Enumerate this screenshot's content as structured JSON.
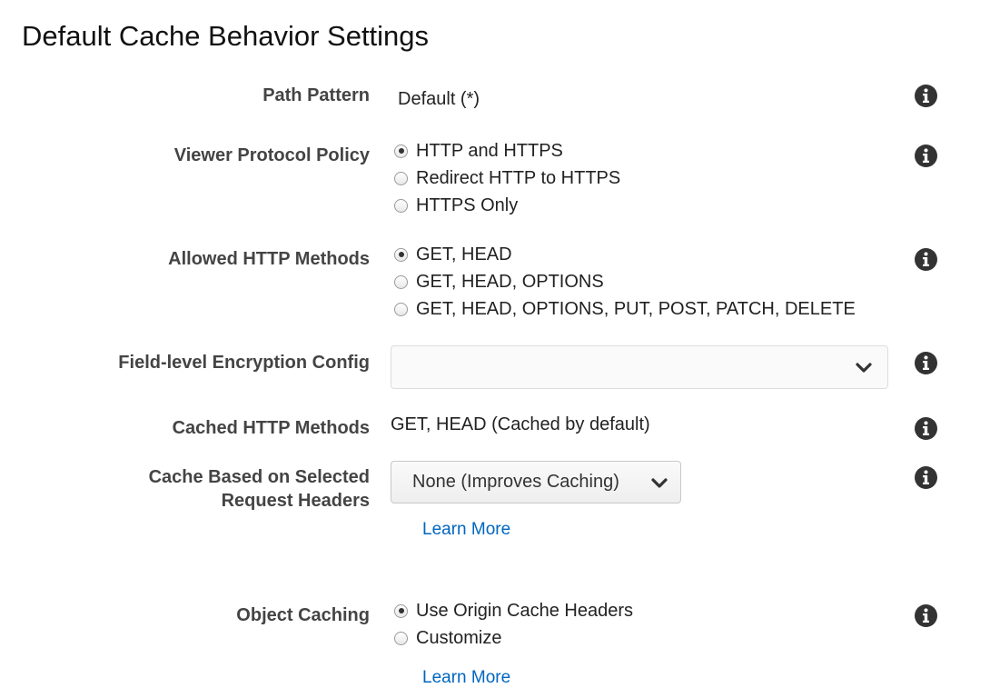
{
  "page": {
    "title": "Default Cache Behavior Settings"
  },
  "path_pattern": {
    "label": "Path Pattern",
    "value": "Default (*)"
  },
  "viewer_protocol_policy": {
    "label": "Viewer Protocol Policy",
    "options": [
      {
        "label": "HTTP and HTTPS",
        "selected": true
      },
      {
        "label": "Redirect HTTP to HTTPS",
        "selected": false
      },
      {
        "label": "HTTPS Only",
        "selected": false
      }
    ]
  },
  "allowed_http_methods": {
    "label": "Allowed HTTP Methods",
    "options": [
      {
        "label": "GET, HEAD",
        "selected": true
      },
      {
        "label": "GET, HEAD, OPTIONS",
        "selected": false
      },
      {
        "label": "GET, HEAD, OPTIONS, PUT, POST, PATCH, DELETE",
        "selected": false
      }
    ]
  },
  "field_level_encryption": {
    "label": "Field-level Encryption Config",
    "selected_value": ""
  },
  "cached_http_methods": {
    "label": "Cached HTTP Methods",
    "value": "GET, HEAD (Cached by default)"
  },
  "cache_based_on_headers": {
    "label_line1": "Cache Based on Selected",
    "label_line2": "Request Headers",
    "selected_value": "None (Improves Caching)",
    "learn_more": "Learn More"
  },
  "object_caching": {
    "label": "Object Caching",
    "options": [
      {
        "label": "Use Origin Cache Headers",
        "selected": true
      },
      {
        "label": "Customize",
        "selected": false
      }
    ],
    "learn_more": "Learn More"
  },
  "colors": {
    "link": "#0066c0",
    "label": "#444444",
    "text": "#222222",
    "icon": "#333333"
  },
  "icons": {
    "info": "info-circle-icon",
    "dropdown": "chevron-down-icon"
  }
}
